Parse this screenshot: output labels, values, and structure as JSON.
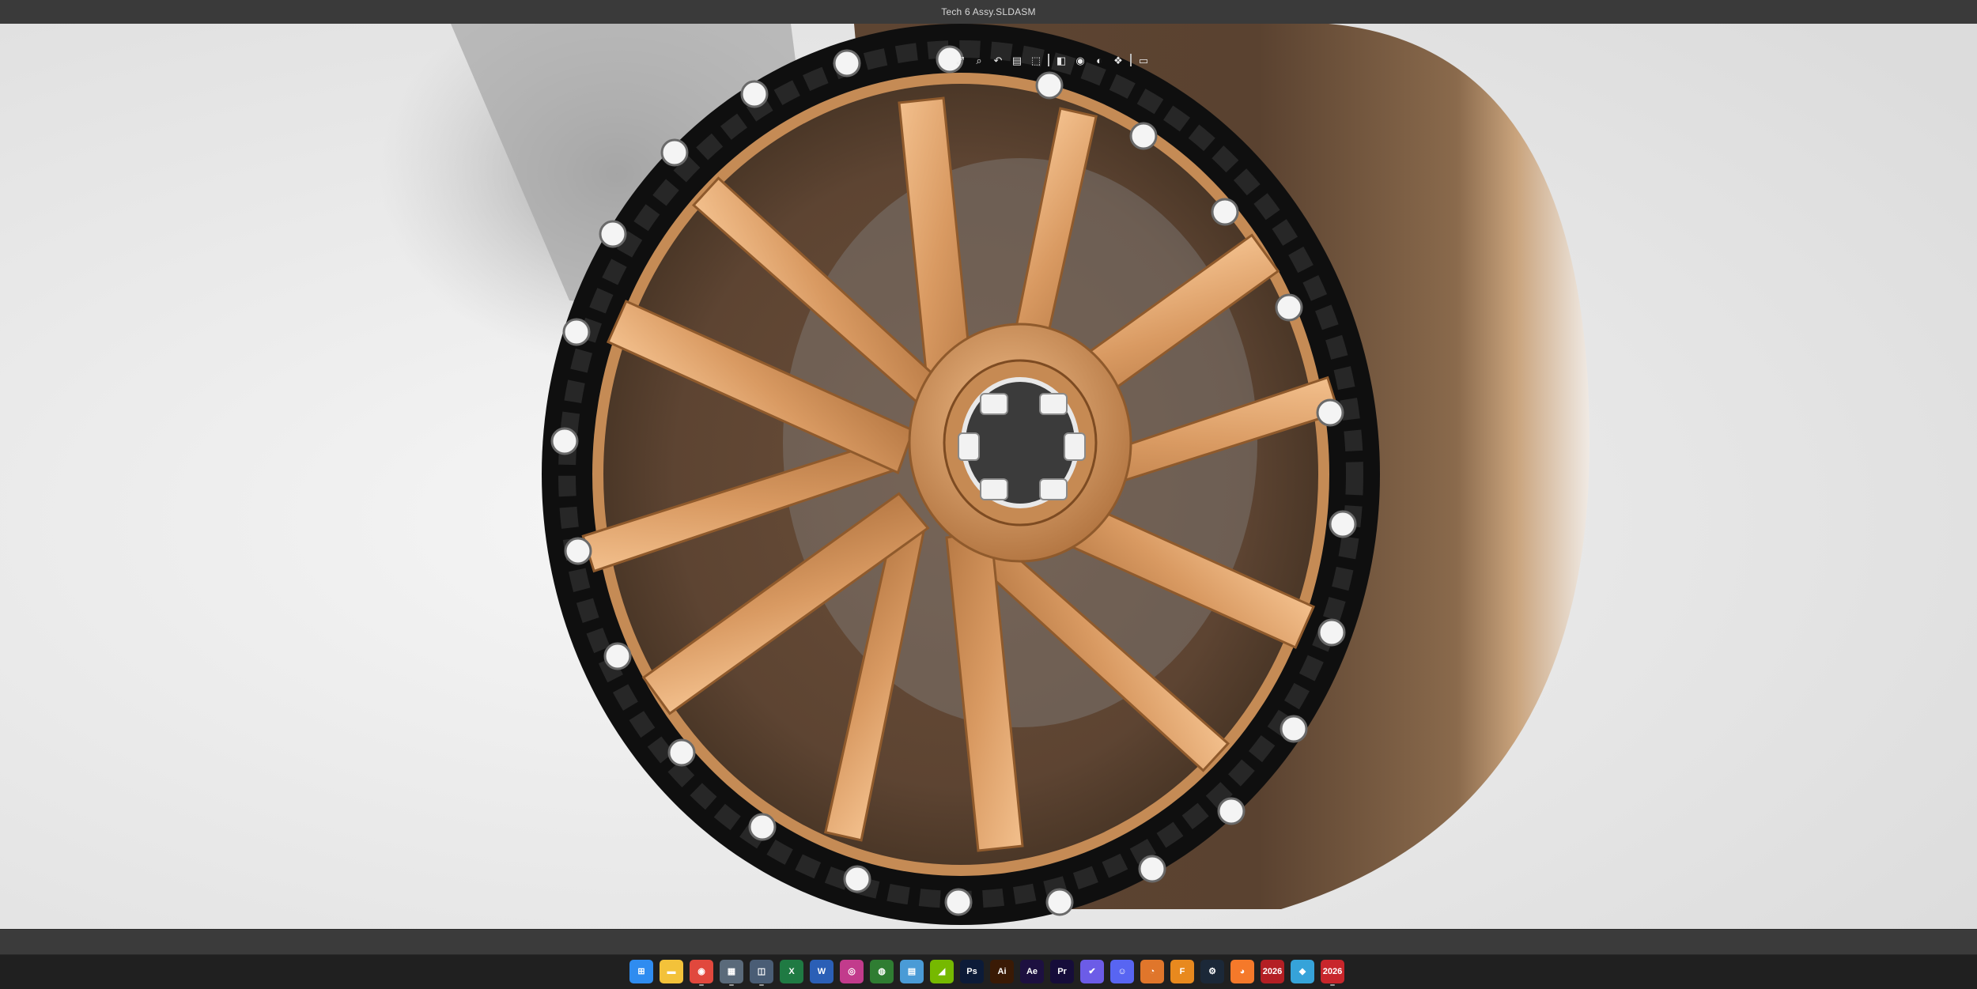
{
  "window": {
    "title": "Tech 6 Assy.SLDASM"
  },
  "viewport": {
    "background": "#f2f2f2",
    "toolbar": [
      {
        "name": "zoom-to-fit-icon",
        "glyph": "⤢"
      },
      {
        "name": "zoom-to-area-icon",
        "glyph": "⌕"
      },
      {
        "name": "previous-view-icon",
        "glyph": "↶"
      },
      {
        "name": "section-view-icon",
        "glyph": "▤"
      },
      {
        "name": "view-orientation-icon",
        "glyph": "⬚"
      },
      {
        "name": "display-style-icon",
        "glyph": "◧"
      },
      {
        "name": "hide-show-items-icon",
        "glyph": "◉"
      },
      {
        "name": "edit-appearance-icon",
        "glyph": "◐"
      },
      {
        "name": "apply-scene-icon",
        "glyph": "❖"
      },
      {
        "name": "view-settings-icon",
        "glyph": "▭"
      }
    ]
  },
  "taskbar": {
    "items": [
      {
        "name": "start-button",
        "label": "",
        "color": "#2f8cf0",
        "glyph": "⊞"
      },
      {
        "name": "file-explorer-icon",
        "label": "",
        "color": "#f3c23a",
        "glyph": "▬"
      },
      {
        "name": "chrome-icon",
        "label": "",
        "color": "#e1483d",
        "glyph": "◉"
      },
      {
        "name": "calculator-icon",
        "label": "",
        "color": "#5a6a7a",
        "glyph": "▦"
      },
      {
        "name": "store-icon",
        "label": "",
        "color": "#4a5d75",
        "glyph": "◫"
      },
      {
        "name": "excel-icon",
        "label": "",
        "color": "#1f7a43",
        "glyph": "X"
      },
      {
        "name": "word-icon",
        "label": "",
        "color": "#2b5fb6",
        "glyph": "W"
      },
      {
        "name": "photos-icon",
        "label": "",
        "color": "#c23b8c",
        "glyph": "◎"
      },
      {
        "name": "xbox-icon",
        "label": "",
        "color": "#2f7d32",
        "glyph": "◍"
      },
      {
        "name": "notepad-icon",
        "label": "",
        "color": "#4a9bd6",
        "glyph": "▤"
      },
      {
        "name": "nvidia-icon",
        "label": "",
        "color": "#76b900",
        "glyph": "◢"
      },
      {
        "name": "photoshop-icon",
        "label": "Ps",
        "color": "#0c1b38",
        "glyph": ""
      },
      {
        "name": "illustrator-icon",
        "label": "Ai",
        "color": "#3a1a05",
        "glyph": ""
      },
      {
        "name": "after-effects-icon",
        "label": "Ae",
        "color": "#1d1040",
        "glyph": ""
      },
      {
        "name": "premiere-icon",
        "label": "Pr",
        "color": "#160d3a",
        "glyph": ""
      },
      {
        "name": "messenger-icon",
        "label": "",
        "color": "#6c5ce7",
        "glyph": "✔"
      },
      {
        "name": "discord-icon",
        "label": "",
        "color": "#5865f2",
        "glyph": "☺"
      },
      {
        "name": "blender-app-icon",
        "label": "",
        "color": "#e0762b",
        "glyph": "◔"
      },
      {
        "name": "fusion-icon",
        "label": "",
        "color": "#e8891e",
        "glyph": "F"
      },
      {
        "name": "steam-icon",
        "label": "",
        "color": "#1b2838",
        "glyph": "⚙"
      },
      {
        "name": "blender-icon",
        "label": "",
        "color": "#f5792a",
        "glyph": "◕"
      },
      {
        "name": "solidworks-2026-icon",
        "label": "2026",
        "color": "#b41f24",
        "glyph": ""
      },
      {
        "name": "cube-app-icon",
        "label": "",
        "color": "#36a3d9",
        "glyph": "◆"
      },
      {
        "name": "solidworks-2026-active-icon",
        "label": "2026",
        "color": "#c8262b",
        "glyph": ""
      }
    ]
  }
}
